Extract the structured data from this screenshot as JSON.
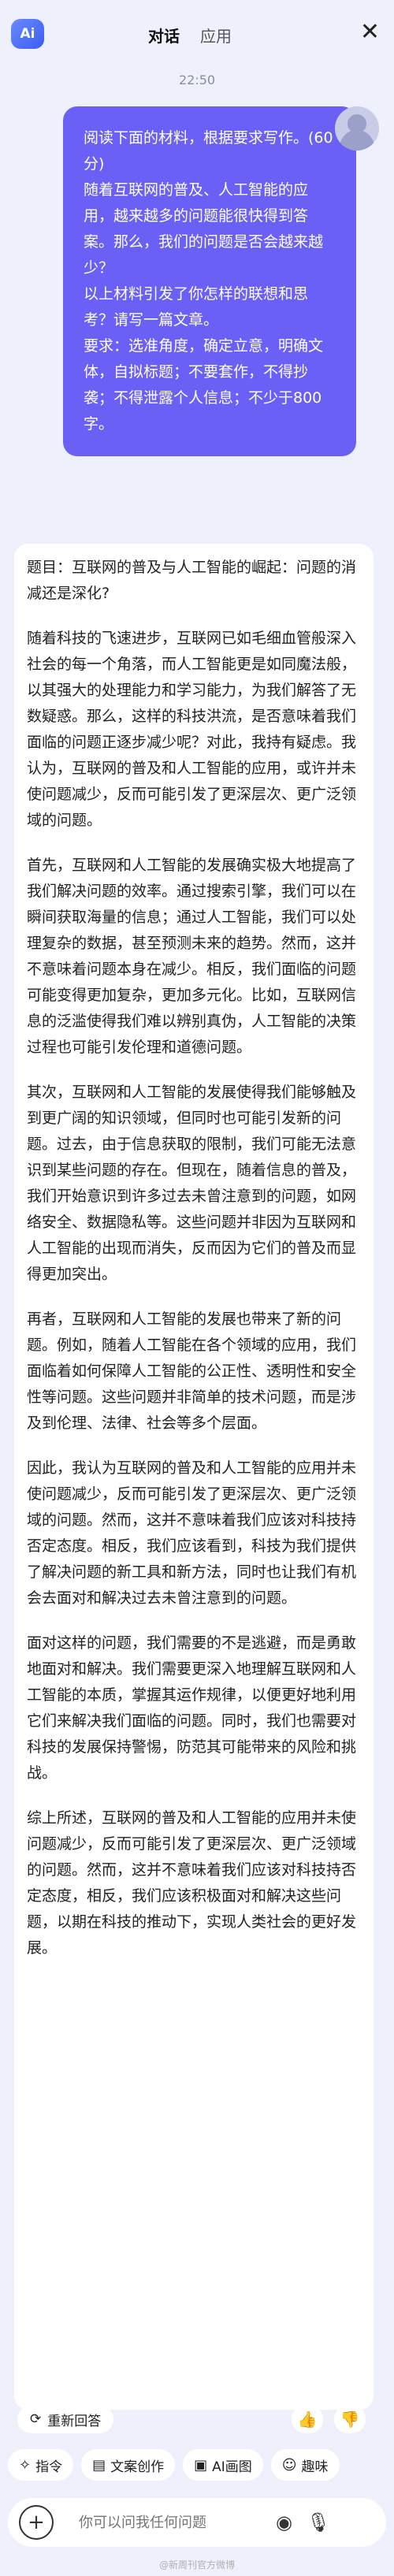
{
  "header": {
    "logo_text": "Ai",
    "tabs": [
      {
        "label": "对话",
        "active": true
      },
      {
        "label": "应用",
        "active": false
      }
    ],
    "close_glyph": "✕"
  },
  "conversation": {
    "timestamp": "22:50",
    "user_message": [
      "阅读下面的材料，根据要求写作。(60分)",
      "随着互联网的普及、人工智能的应用，越来越多的问题能很快得到答案。那么，我们的问题是否会越来越少？",
      "以上材料引发了你怎样的联想和思考？请写一篇文章。",
      "要求：选准角度，确定立意，明确文体，自拟标题；不要套作，不得抄袭；不得泄露个人信息；不少于800字。"
    ],
    "answer": [
      "题目：互联网的普及与人工智能的崛起：问题的消减还是深化?",
      "随着科技的飞速进步，互联网已如毛细血管般深入社会的每一个角落，而人工智能更是如同魔法般，以其强大的处理能力和学习能力，为我们解答了无数疑惑。那么，这样的科技洪流，是否意味着我们面临的问题正逐步减少呢？对此，我持有疑虑。我认为，互联网的普及和人工智能的应用，或许并未使问题减少，反而可能引发了更深层次、更广泛领域的问题。",
      "首先，互联网和人工智能的发展确实极大地提高了我们解决问题的效率。通过搜索引擎，我们可以在瞬间获取海量的信息；通过人工智能，我们可以处理复杂的数据，甚至预测未来的趋势。然而，这并不意味着问题本身在减少。相反，我们面临的问题可能变得更加复杂，更加多元化。比如，互联网信息的泛滥使得我们难以辨别真伪，人工智能的决策过程也可能引发伦理和道德问题。",
      "其次，互联网和人工智能的发展使得我们能够触及到更广阔的知识领域，但同时也可能引发新的问题。过去，由于信息获取的限制，我们可能无法意识到某些问题的存在。但现在，随着信息的普及，我们开始意识到许多过去未曾注意到的问题，如网络安全、数据隐私等。这些问题并非因为互联网和人工智能的出现而消失，反而因为它们的普及而显得更加突出。",
      "再者，互联网和人工智能的发展也带来了新的问题。例如，随着人工智能在各个领域的应用，我们面临着如何保障人工智能的公正性、透明性和安全性等问题。这些问题并非简单的技术问题，而是涉及到伦理、法律、社会等多个层面。",
      "因此，我认为互联网的普及和人工智能的应用并未使问题减少，反而可能引发了更深层次、更广泛领域的问题。然而，这并不意味着我们应该对科技持否定态度。相反，我们应该看到，科技为我们提供了解决问题的新工具和新方法，同时也让我们有机会去面对和解决过去未曾注意到的问题。",
      "面对这样的问题，我们需要的不是逃避，而是勇敢地面对和解决。我们需要更深入地理解互联网和人工智能的本质，掌握其运作规律，以便更好地利用它们来解决我们面临的问题。同时，我们也需要对科技的发展保持警惕，防范其可能带来的风险和挑战。",
      "综上所述，互联网的普及和人工智能的应用并未使问题减少，反而可能引发了更深层次、更广泛领域的问题。然而，这并不意味着我们应该对科技持否定态度，相反，我们应该积极面对和解决这些问题，以期在科技的推动下，实现人类社会的更好发展。"
    ]
  },
  "actions": {
    "regenerate_label": "重新回答",
    "regenerate_icon": "refresh-icon",
    "thumb_up": "👍",
    "thumb_down": "👎"
  },
  "chips": [
    {
      "icon": "✧",
      "label": "指令"
    },
    {
      "icon": "▤",
      "label": "文案创作"
    },
    {
      "icon": "▣",
      "label": "AI画图"
    },
    {
      "icon": "☺",
      "label": "趣味"
    }
  ],
  "composer": {
    "placeholder": "你可以问我任何问题",
    "plus_glyph": "+",
    "camera_glyph": "◉",
    "mic_glyph": "🎙"
  },
  "watermark": "@新周刊官方微博"
}
